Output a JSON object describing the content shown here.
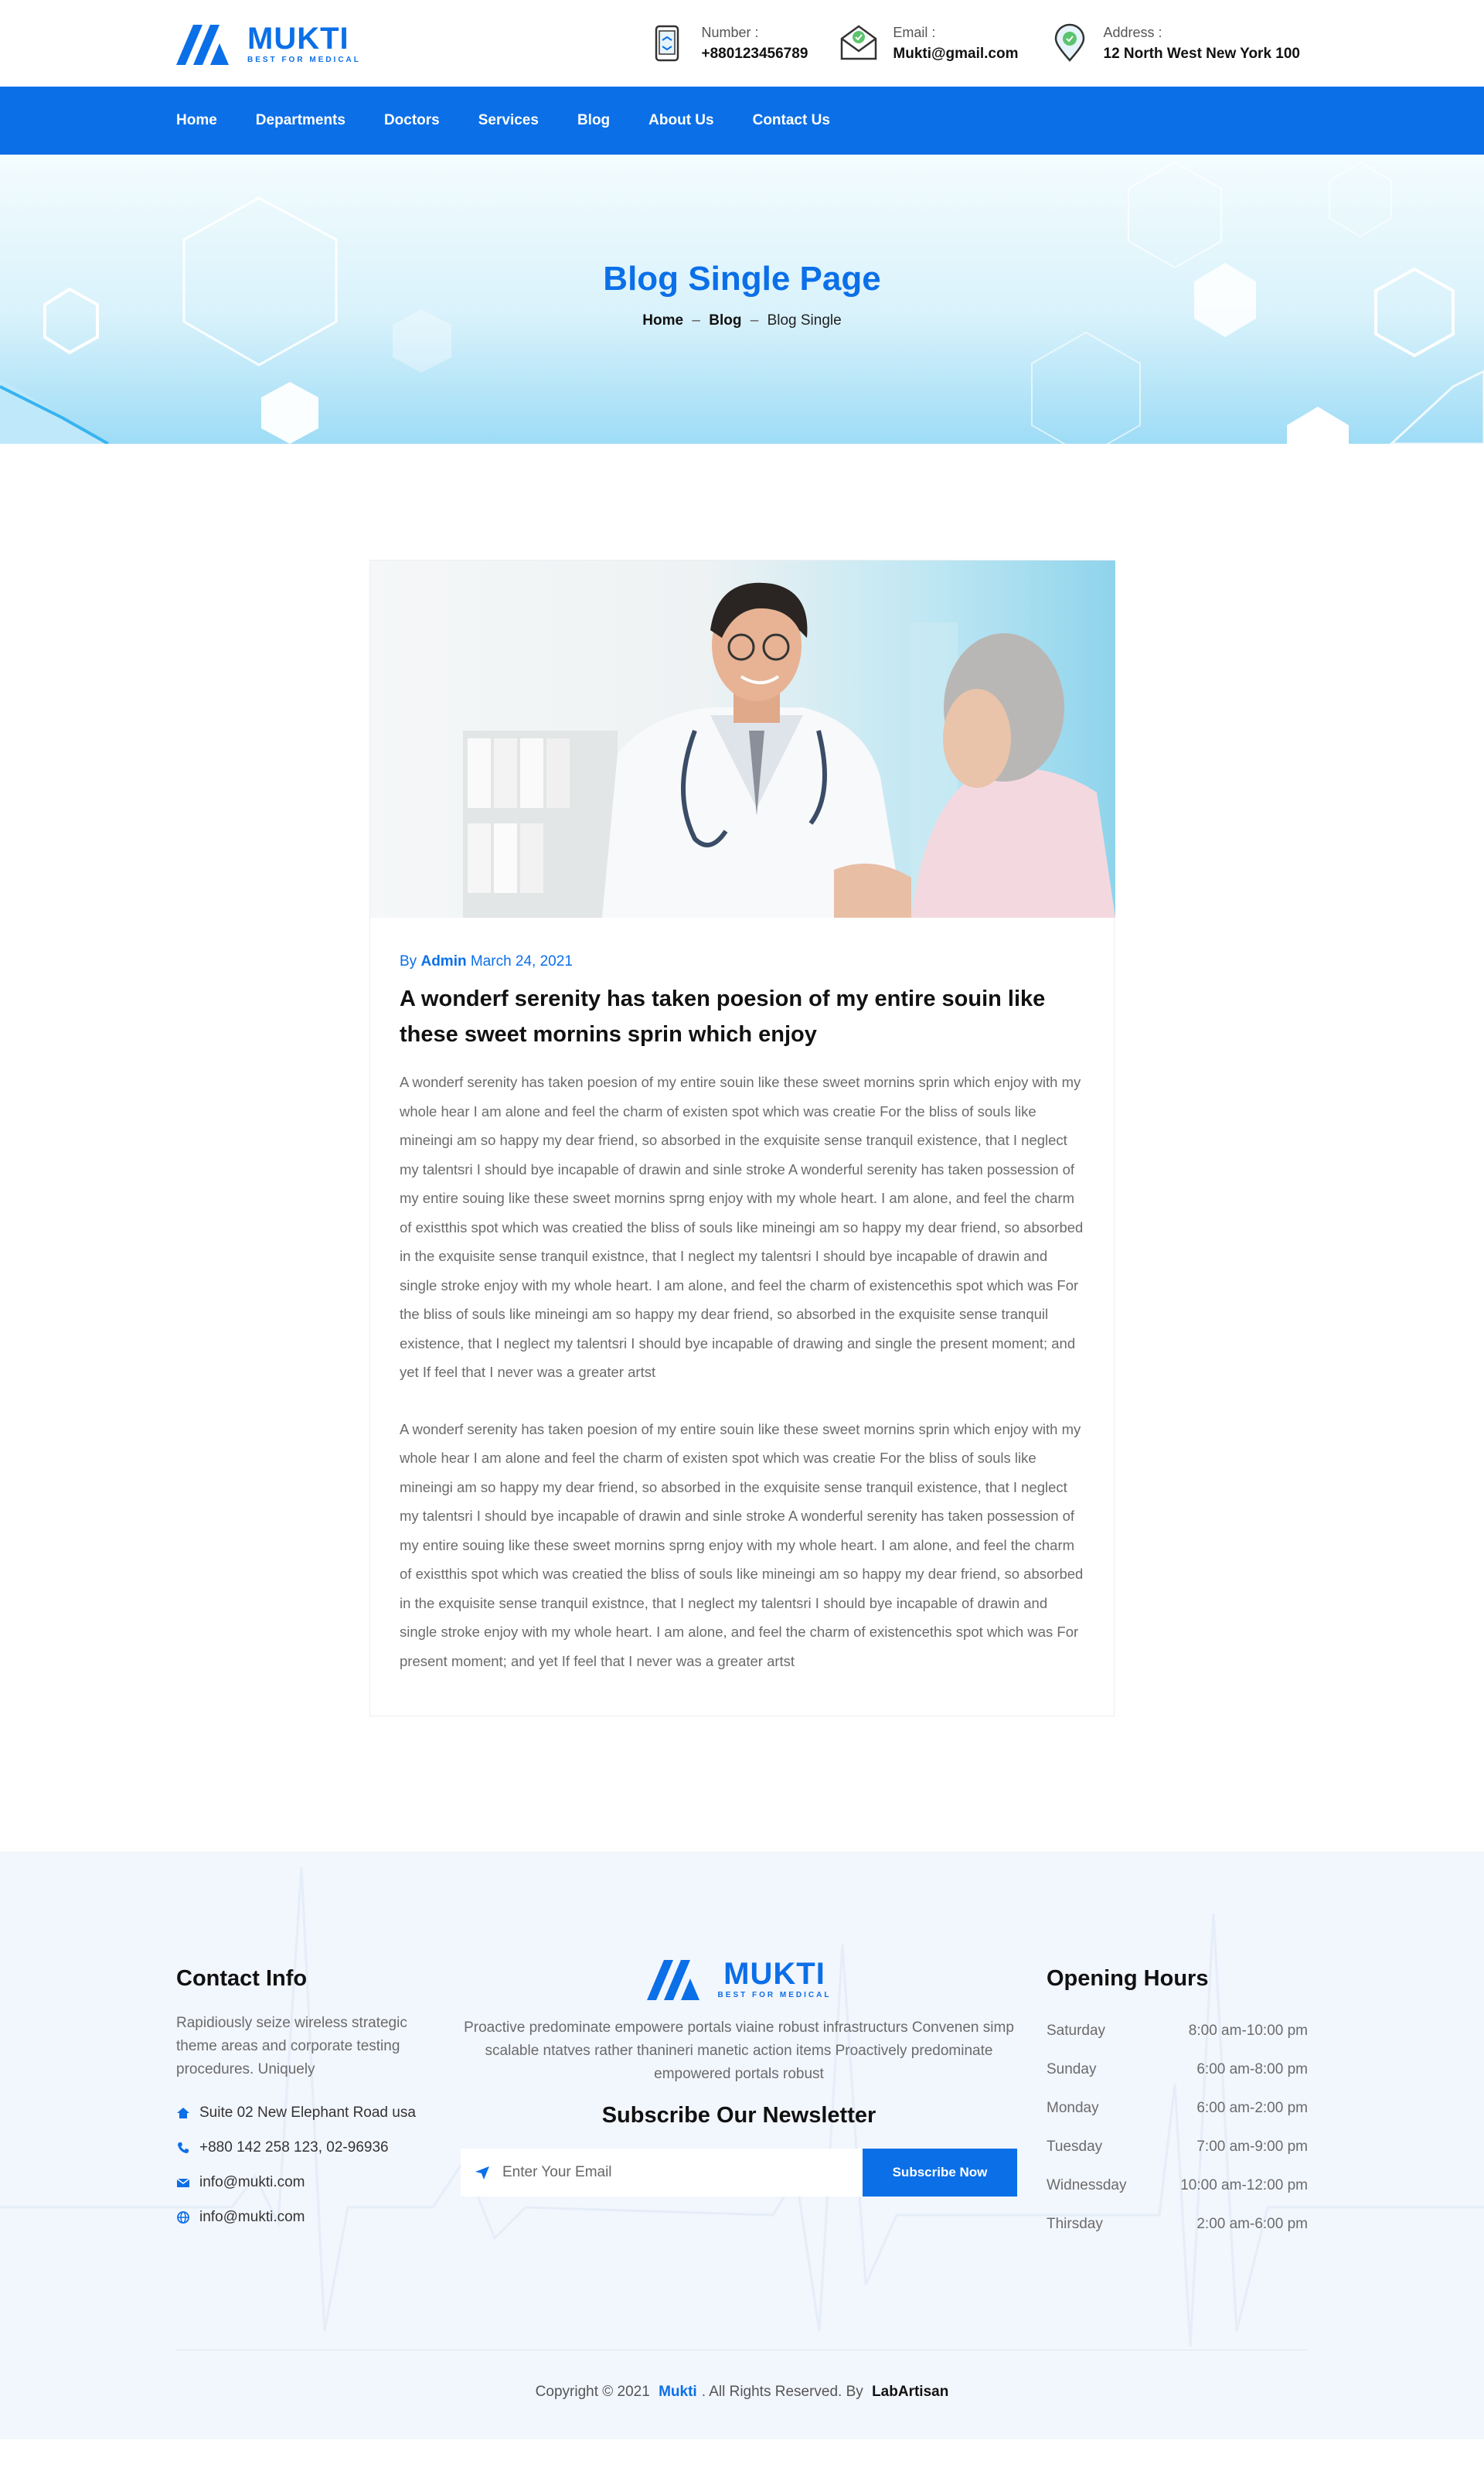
{
  "brand": {
    "name": "MUKTI",
    "tagline": "BEST FOR MEDICAL",
    "primary_color": "#0b6fe8"
  },
  "header": {
    "contacts": [
      {
        "icon": "phone-icon",
        "label": "Number :",
        "value": "+880123456789"
      },
      {
        "icon": "mail-icon",
        "label": "Email :",
        "value": "Mukti@gmail.com"
      },
      {
        "icon": "location-pin-icon",
        "label": "Address :",
        "value": "12 North West New York 100"
      }
    ]
  },
  "nav": {
    "items": [
      "Home",
      "Departments",
      "Doctors",
      "Services",
      "Blog",
      "About Us",
      "Contact Us"
    ]
  },
  "hero": {
    "title": "Blog Single Page",
    "breadcrumb": {
      "home": "Home",
      "sep": "–",
      "blog": "Blog",
      "current": "Blog Single"
    }
  },
  "post": {
    "by": "By",
    "author": "Admin",
    "date": "March 24, 2021",
    "title": "A wonderf serenity has taken poesion of my entire souin like these sweet mornins sprin which enjoy",
    "paragraphs": [
      "A wonderf serenity has taken poesion of my entire souin like these sweet mornins sprin which enjoy with my whole hear I am alone and feel the charm of existen spot which was creatie For the bliss of souls like mineingi am so happy my dear friend, so absorbed in the exquisite sense tranquil existence, that I neglect my talentsri I should bye incapable of drawin and sinle stroke A wonderful serenity has taken possession of my entire souing like these sweet mornins sprng enjoy with my whole heart. I am alone, and feel the charm of existthis spot which was creatied the bliss of souls like mineingi am so happy my dear friend, so absorbed in the exquisite sense tranquil existnce, that I neglect my talentsri I should bye incapable of drawin and single stroke enjoy with my whole heart. I am alone, and feel the charm of existencethis spot which was For the bliss of souls like mineingi am so happy my dear friend, so absorbed in the exquisite sense tranquil existence, that I neglect my talentsri I should bye incapable of drawing and single the present moment; and yet If feel that I never was a greater artst",
      "A wonderf serenity has taken poesion of my entire souin like these sweet mornins sprin which enjoy with my whole hear I am alone and feel the charm of existen spot which was creatie For the bliss of souls like mineingi am so happy my dear friend, so absorbed in the exquisite sense tranquil existence, that I neglect my talentsri I should bye incapable of drawin and sinle stroke A wonderful serenity has taken possession of my entire souing like these sweet mornins sprng enjoy with my whole heart. I am alone, and feel the charm of existthis spot which was creatied the bliss of souls like mineingi am so happy my dear friend, so absorbed in the exquisite sense tranquil existnce, that I neglect my talentsri I should bye incapable of drawin and single stroke enjoy with my whole heart. I am alone, and feel the charm of existencethis spot which was For present moment; and yet If feel that I never was a greater artst"
    ]
  },
  "footer": {
    "contact": {
      "heading": "Contact Info",
      "text": "Rapidiously seize wireless strategic theme areas and corporate testing procedures. Uniquely",
      "items": [
        {
          "icon": "home-icon",
          "text": "Suite 02 New Elephant Road usa"
        },
        {
          "icon": "phone-icon",
          "text": "+880 142 258 123, 02-96936"
        },
        {
          "icon": "mail-icon",
          "text": "info@mukti.com"
        },
        {
          "icon": "globe-icon",
          "text": "info@mukti.com"
        }
      ]
    },
    "about": "Proactive predominate empowere portals viaine robust infrastructurs Convenen simp scalable ntatves rather thanineri manetic action items Proactively predominate empowered portals robust",
    "newsletter": {
      "heading": "Subscribe Our Newsletter",
      "placeholder": "Enter Your Email",
      "button": "Subscribe Now"
    },
    "hours": {
      "heading": "Opening Hours",
      "rows": [
        {
          "day": "Saturday",
          "time": "8:00 am-10:00 pm"
        },
        {
          "day": "Sunday",
          "time": "6:00 am-8:00 pm"
        },
        {
          "day": "Monday",
          "time": "6:00 am-2:00 pm"
        },
        {
          "day": "Tuesday",
          "time": "7:00 am-9:00 pm"
        },
        {
          "day": "Widnessday",
          "time": "10:00 am-12:00 pm"
        },
        {
          "day": "Thirsday",
          "time": "2:00 am-6:00 pm"
        }
      ]
    },
    "copyright": {
      "prefix": "Copyright © 2021",
      "brand": "Mukti",
      "middle": ". All Rights Reserved. By",
      "author": "LabArtisan"
    }
  }
}
